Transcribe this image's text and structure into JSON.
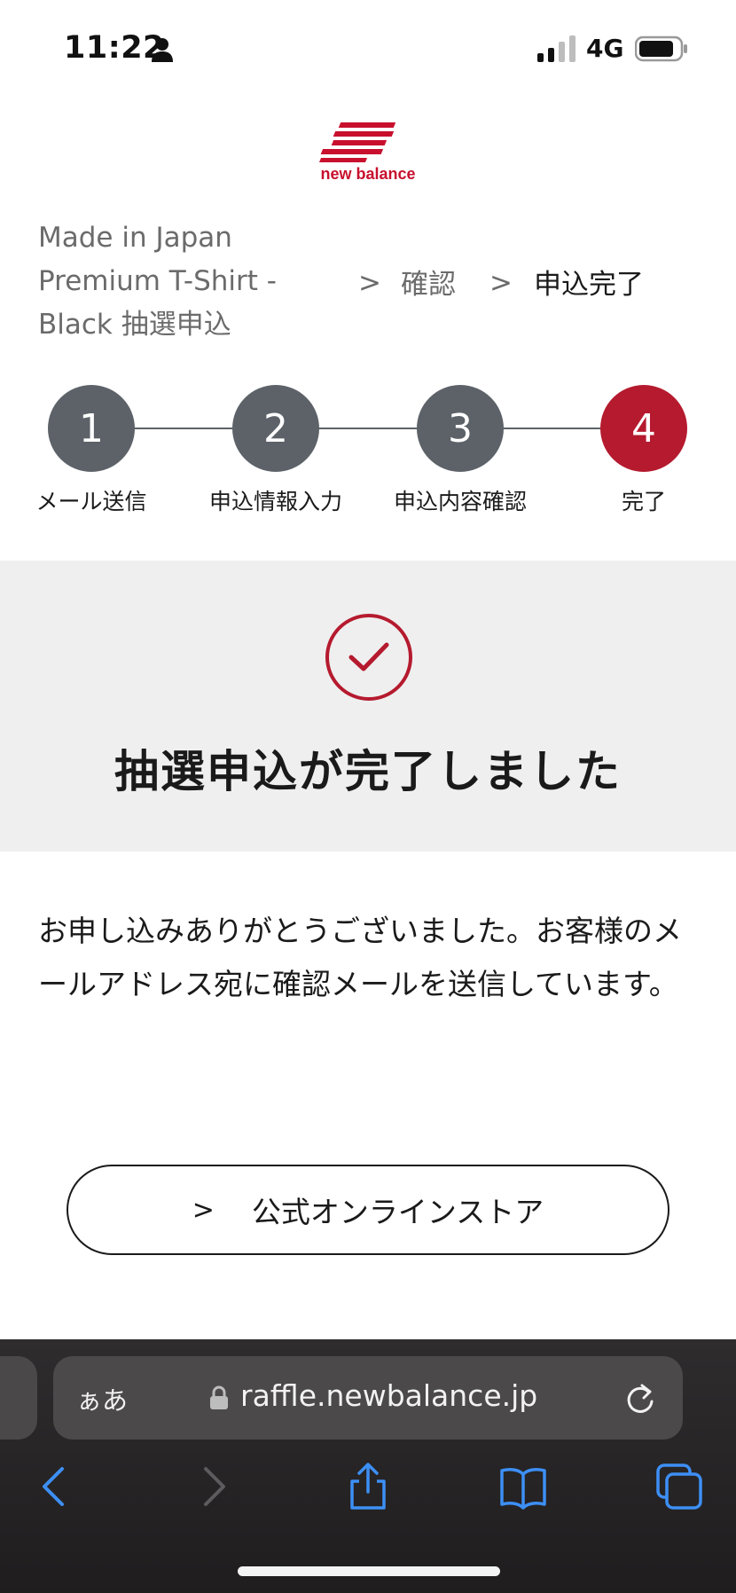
{
  "status_bar": {
    "time": "11:22",
    "network": "4G",
    "icons": [
      "person-icon",
      "signal-icon",
      "battery-icon"
    ]
  },
  "logo": {
    "text": "new balance",
    "color": "#c8102e"
  },
  "breadcrumb": {
    "product": "Made in Japan Premium T-Shirt - Black 抽選申込",
    "separator": ">",
    "confirm": "確認",
    "complete": "申込完了"
  },
  "steps": [
    {
      "number": "1",
      "label": "メール送信",
      "active": false
    },
    {
      "number": "2",
      "label": "申込情報入力",
      "active": false
    },
    {
      "number": "3",
      "label": "申込内容確認",
      "active": false
    },
    {
      "number": "4",
      "label": "完了",
      "active": true
    }
  ],
  "completion": {
    "title": "抽選申込が完了しました",
    "icon": "check-circle-icon"
  },
  "message": "お申し込みありがとうございました。お客様のメールアドレス宛に確認メールを送信しています。",
  "store_button": {
    "chevron": ">",
    "label": "公式オンラインストア"
  },
  "browser": {
    "aa_label": "ぁあ",
    "url": "raffle.newbalance.jp",
    "toolbar_icons": [
      "back-icon",
      "forward-icon",
      "share-icon",
      "bookmarks-icon",
      "tabs-icon"
    ]
  },
  "colors": {
    "accent": "#b51a2e",
    "step_inactive": "#5c6268",
    "band_bg": "#efefef",
    "browser_blue": "#3d8ff5"
  }
}
